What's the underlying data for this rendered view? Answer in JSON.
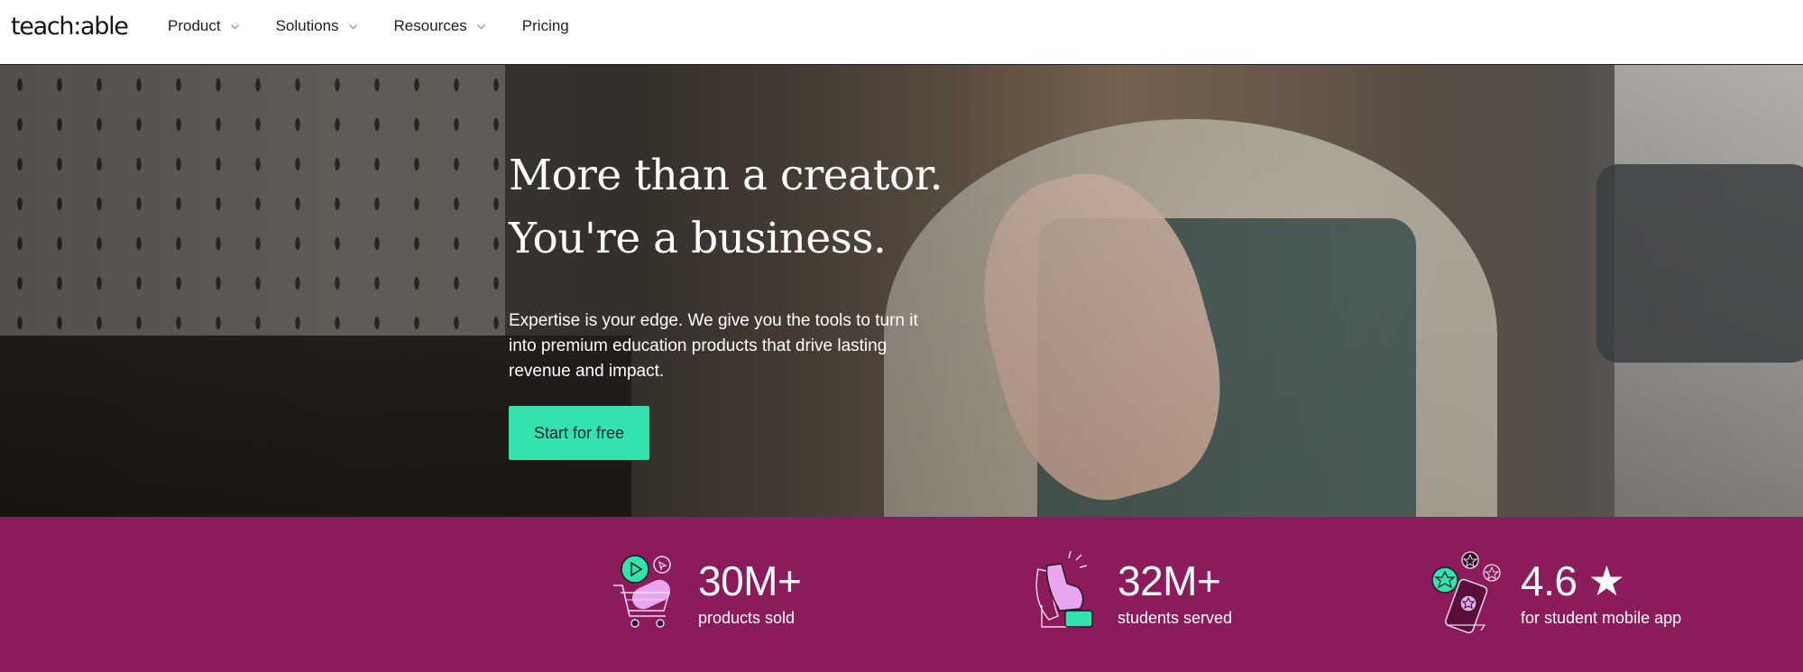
{
  "brand": {
    "logo_text": "teach:able"
  },
  "nav": {
    "items": [
      {
        "label": "Product",
        "has_dropdown": true
      },
      {
        "label": "Solutions",
        "has_dropdown": true
      },
      {
        "label": "Resources",
        "has_dropdown": true
      },
      {
        "label": "Pricing",
        "has_dropdown": false
      }
    ]
  },
  "hero": {
    "title_line1": "More than a creator.",
    "title_line2": "You're a business.",
    "subtitle": "Expertise is your edge. We give you the tools to turn it into premium education products that drive lasting revenue and impact.",
    "cta_label": "Start for free"
  },
  "stats": [
    {
      "value": "30M+",
      "label": "products sold",
      "icon": "shopping-cart-illustration"
    },
    {
      "value": "32M+",
      "label": "students served",
      "icon": "clapping-hands-illustration"
    },
    {
      "value": "4.6 ★",
      "label": "for student mobile app",
      "icon": "mobile-rating-illustration"
    }
  ],
  "colors": {
    "accent": "#34e2b0",
    "stats_bg": "#8b1b5b",
    "illustration_pink": "#e9a6f0"
  }
}
